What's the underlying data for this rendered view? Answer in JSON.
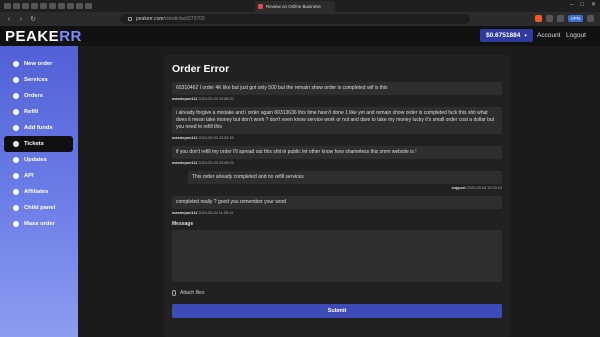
{
  "browser": {
    "active_tab_title": "Review on Online Business",
    "url_domain": "peakerr.com",
    "url_path": "/viewticket/273703",
    "vpn_label": "VPN"
  },
  "header": {
    "logo_main": "PEAKE",
    "logo_accent": "RR",
    "balance": "$0.6751884",
    "account_label": "Account",
    "logout_label": "Logout"
  },
  "sidebar": {
    "items": [
      {
        "label": "New order",
        "icon": "cart-icon"
      },
      {
        "label": "Services",
        "icon": "list-icon"
      },
      {
        "label": "Orders",
        "icon": "orders-icon"
      },
      {
        "label": "Refill",
        "icon": "refill-icon"
      },
      {
        "label": "Add funds",
        "icon": "wallet-icon"
      },
      {
        "label": "Tickets",
        "icon": "ticket-icon"
      },
      {
        "label": "Updates",
        "icon": "bell-icon"
      },
      {
        "label": "API",
        "icon": "code-icon"
      },
      {
        "label": "Affiliates",
        "icon": "users-icon"
      },
      {
        "label": "Child panel",
        "icon": "panel-icon"
      },
      {
        "label": "Mass order",
        "icon": "stack-icon"
      }
    ],
    "active_index": 5
  },
  "ticket": {
    "title": "Order Error",
    "messages": [
      {
        "text": "60310462 I order 4K like but just got only 500 but the remain show order is completed wtf is this",
        "author": "masterpon111",
        "time": "2024-03-03 22:58:20",
        "from_support": false
      },
      {
        "text": "i already forgive a mistake and i order again 60313636 this time havn't done 1 like yet and remain show order is completed fuck this shit what does it mean take money but don't work ? don't even know service work or not and dare to take my money lucky it's small order cost a dollar but you need to refill this",
        "author": "masterpon111",
        "time": "2024-03-03 23:02:15",
        "from_support": false
      },
      {
        "text": "if you don't refill my order I'll spread out this shit in public let other know how shameless this smm website is !",
        "author": "masterpon111",
        "time": "2024-03-03 23:06:09",
        "from_support": false
      },
      {
        "text": "This order already completed and no refill services",
        "author": "support",
        "time": "2024-03-04 10:29:15",
        "from_support": true
      },
      {
        "text": "completed really ? good you remember your word",
        "author": "masterpon111",
        "time": "2024-03-04 11:39:11",
        "from_support": false
      }
    ],
    "message_label": "Message",
    "attach_label": "Attach files",
    "submit_label": "Submit"
  }
}
